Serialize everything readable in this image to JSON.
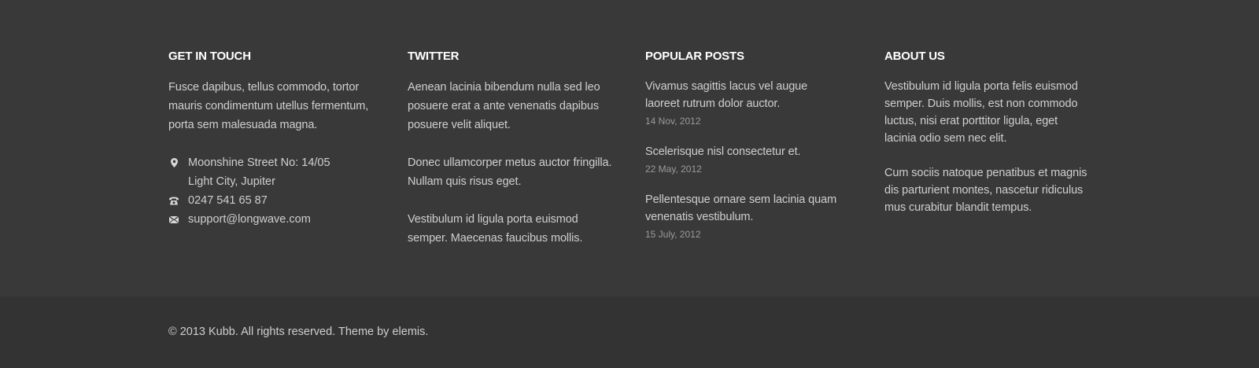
{
  "footer": {
    "get_in_touch": {
      "title": "GET IN TOUCH",
      "intro": "Fusce dapibus, tellus commodo, tortor mauris condimentum utellus fermentum, porta sem malesuada magna.",
      "address_line1": "Moonshine Street No: 14/05",
      "address_line2": "Light City, Jupiter",
      "phone": "0247 541 65 87",
      "email": "support@longwave.com",
      "icons": {
        "address": "map-pin-icon",
        "phone": "phone-icon",
        "email": "envelope-icon"
      }
    },
    "twitter": {
      "title": "TWITTER",
      "tweets": [
        "Aenean lacinia bibendum nulla sed leo posuere erat a ante venenatis dapibus posuere velit aliquet.",
        "Donec ullamcorper metus auctor fringilla. Nullam quis risus eget.",
        "Vestibulum id ligula porta  euismod semper. Maecenas faucibus mollis."
      ]
    },
    "popular_posts": {
      "title": "POPULAR POSTS",
      "posts": [
        {
          "title": "Vivamus sagittis lacus vel augue laoreet rutrum dolor auctor.",
          "date": "14 Nov, 2012"
        },
        {
          "title": "Scelerisque nisl consectetur et.",
          "date": "22 May, 2012"
        },
        {
          "title": "Pellentesque ornare sem lacinia quam venenatis vestibulum.",
          "date": "15 July, 2012"
        }
      ]
    },
    "about_us": {
      "title": "ABOUT US",
      "paragraphs": [
        "Vestibulum id ligula porta felis euismod semper. Duis mollis, est non commodo luctus, nisi erat porttitor ligula, eget lacinia odio sem nec elit.",
        "Cum sociis natoque penatibus et magnis dis parturient montes, nascetur ridiculus mus curabitur blandit tempus."
      ]
    }
  },
  "sub_footer": {
    "copyright_prefix": "© 2013 Kubb. All rights reserved. Theme by ",
    "theme_author": "elemis",
    "copyright_suffix": "."
  },
  "colors": {
    "widgets_bg": "#393939",
    "sub_footer_bg": "#333333",
    "heading": "#ffffff",
    "text": "#cfcfcf",
    "meta": "#9a9a9a"
  }
}
